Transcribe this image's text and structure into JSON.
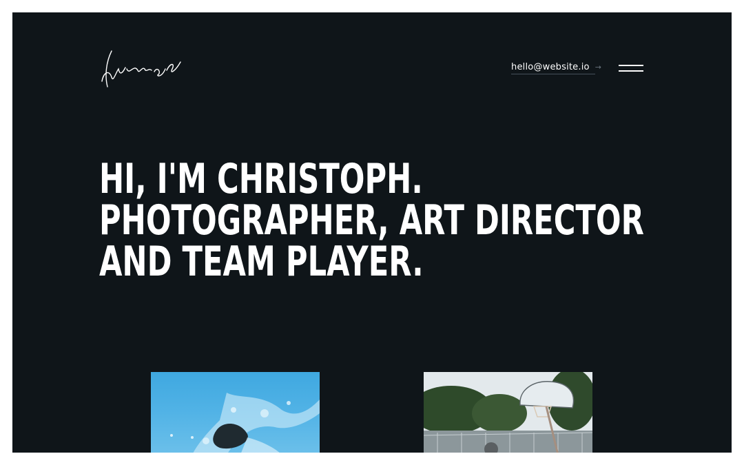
{
  "header": {
    "logo_alt": "signature logo",
    "email": "hello@website.io",
    "email_arrow": "→",
    "menu_icon": "hamburger-menu-icon"
  },
  "hero": {
    "lines": [
      "HI, I'M CHRISTOPH.",
      "PHOTOGRAPHER, ART DIRECTOR",
      "AND TEAM PLAYER."
    ]
  },
  "gallery": {
    "items": [
      {
        "subject": "water splash"
      },
      {
        "subject": "basketball court"
      }
    ]
  },
  "colors": {
    "background": "#0f1519",
    "text": "#ffffff",
    "page": "#ffffff"
  }
}
